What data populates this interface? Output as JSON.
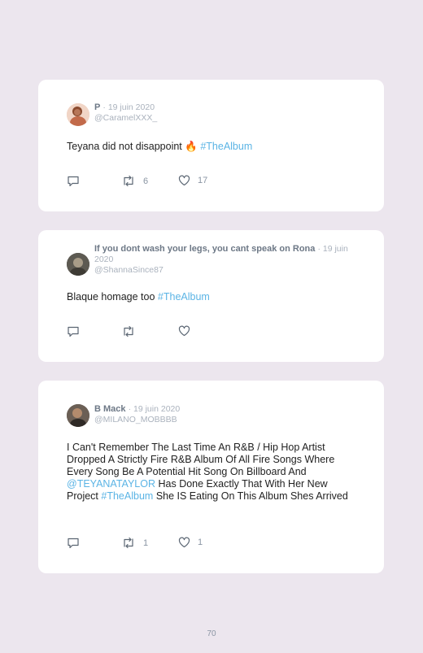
{
  "tweets": [
    {
      "name": "P",
      "date": "· 19 juin 2020",
      "handle": "@CaramelXXX_",
      "text": "Teyana did not disappoint",
      "emoji": "🔥",
      "hashtag": "#TheAlbum",
      "retweets": "6",
      "likes": "17"
    },
    {
      "name": "If you dont wash your legs, you cant speak on Rona",
      "date": "· 19 juin 2020",
      "handle": "@ShannaSince87",
      "text": "Blaque homage too",
      "hashtag": "#TheAlbum",
      "retweets": "",
      "likes": ""
    },
    {
      "name": "B Mack",
      "date": "· 19 juin 2020",
      "handle": "@MILANO_MOBBBB",
      "text_part1": "I Can't Remember The Last Time An R&B / Hip Hop Artist Dropped A Strictly Fire R&B Album Of All Fire Songs Where Every Song Be A Potential Hit Song On Billboard And",
      "mention": "@TEYANATAYLOR",
      "text_part2": "Has Done Exactly That With Her New Project",
      "hashtag": "#TheAlbum",
      "text_part3": "She IS Eating On This Album Shes Arrived",
      "retweets": "1",
      "likes": "1"
    }
  ],
  "page_number": "70",
  "colors": {
    "background": "#ece6ee",
    "card": "#ffffff",
    "link": "#5bb4e5",
    "muted": "#8a95a3"
  }
}
